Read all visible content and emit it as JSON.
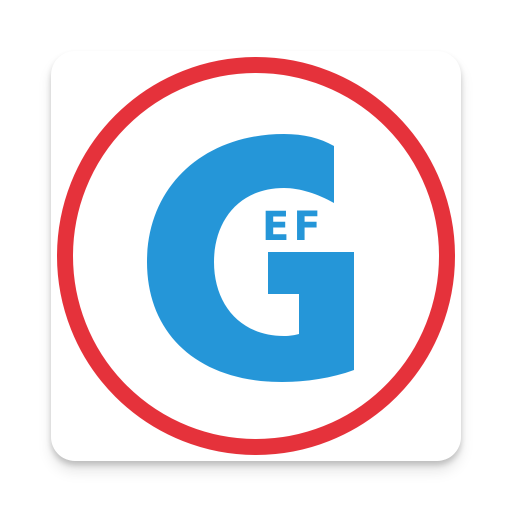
{
  "app_icon": {
    "name": "GEF",
    "logo_letter": "G",
    "logo_subtext": "EF"
  },
  "colors": {
    "ring": "#e5323b",
    "letter": "#2596d8",
    "tile": "#ffffff"
  }
}
